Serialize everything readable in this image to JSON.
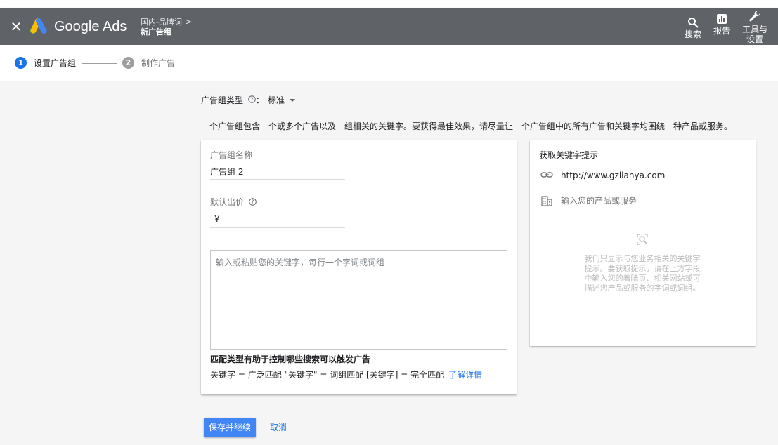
{
  "header": {
    "close_icon": "close-icon",
    "brand": "Google Ads",
    "breadcrumb_parent": "国内-品牌词",
    "breadcrumb_chevron": ">",
    "breadcrumb_current": "新广告组",
    "tools": {
      "search_label": "搜索",
      "reports_label": "报告",
      "tools_label_line1": "工具与",
      "tools_label_line2": "设置"
    },
    "colors": {
      "bar": "#5f6368",
      "logo_blue": "#4285f4",
      "logo_yellow": "#fbbc04",
      "logo_green": "#34a853"
    }
  },
  "stepper": {
    "steps": [
      {
        "number": "1",
        "label": "设置广告组",
        "active": true
      },
      {
        "number": "2",
        "label": "制作广告",
        "active": false
      }
    ]
  },
  "form": {
    "adgroup_type_label": "广告组类型",
    "adgroup_type_colon": "：",
    "adgroup_type_value": "标准",
    "description": "一个广告组包含一个或多个广告以及一组相关的关键字。要获得最佳效果，请尽量让一个广告组中的所有广告和关键字均围绕一种产品或服务。",
    "adgroup_name_label": "广告组名称",
    "adgroup_name_value": "广告组 2",
    "default_bid_label": "默认出价",
    "currency_symbol": "¥",
    "keywords_placeholder": "输入或粘贴您的关键字，每行一个字词或词组",
    "match_types_title": "匹配类型有助于控制哪些搜索可以触发广告",
    "match_types_desc": "关键字 = 广泛匹配  \"关键字\" = 词组匹配  [关键字] = 完全匹配",
    "learn_more": "了解详情"
  },
  "keyword_ideas": {
    "title": "获取关键字提示",
    "url_value": "http://www.gzlianya.com",
    "product_placeholder": "输入您的产品或服务",
    "empty_message": "我们只显示与您业务相关的关键字提示。要获取提示，请在上方字段中输入您的着陆页、相关网站或可描述您产品或服务的字词或词组。"
  },
  "actions": {
    "save_label": "保存并继续",
    "cancel_label": "取消"
  }
}
